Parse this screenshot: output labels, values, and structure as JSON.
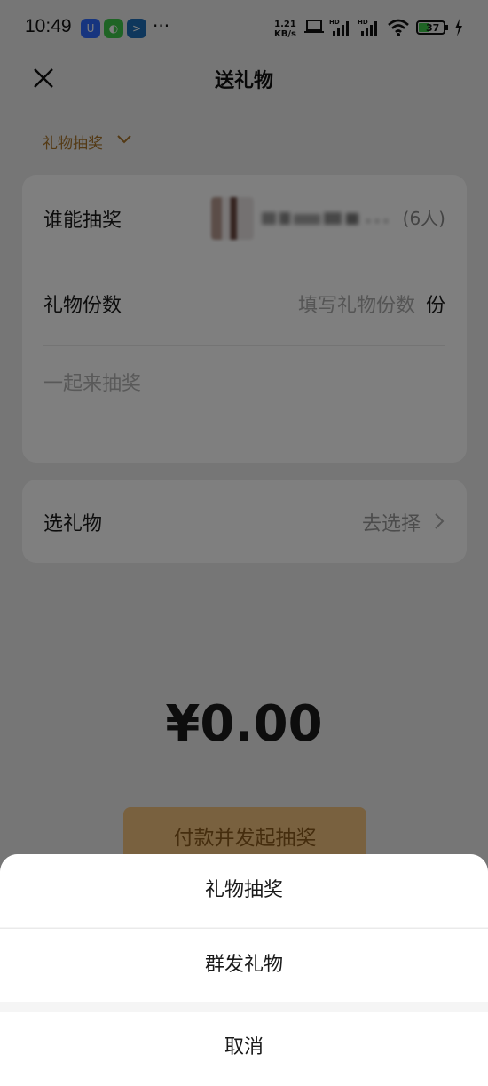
{
  "status_bar": {
    "time": "10:49",
    "speed_value": "1.21",
    "speed_unit": "KB/s",
    "battery": "37",
    "app_icons": [
      "shield-app-icon",
      "wechat-icon",
      "terminal-app-icon"
    ],
    "colors": {
      "shield": "#2f6bff",
      "wechat": "#3fc84b",
      "terminal": "#1e6fb8"
    }
  },
  "header": {
    "title": "送礼物"
  },
  "mode_selector": {
    "label": "礼物抽奖"
  },
  "lottery_card": {
    "who_label": "谁能抽奖",
    "who_count": "(6人)",
    "count_label": "礼物份数",
    "count_placeholder": "填写礼物份数",
    "count_unit": "份",
    "message_placeholder": "一起来抽奖"
  },
  "gift_card": {
    "label": "选礼物",
    "action": "去选择"
  },
  "amount": "¥0.00",
  "pay_button": {
    "label": "付款并发起抽奖"
  },
  "action_sheet": {
    "options": [
      "礼物抽奖",
      "群发礼物"
    ],
    "cancel": "取消"
  },
  "colors": {
    "accent": "#a9742a",
    "pay_button": "#f2c27f",
    "background": "#ededed"
  }
}
